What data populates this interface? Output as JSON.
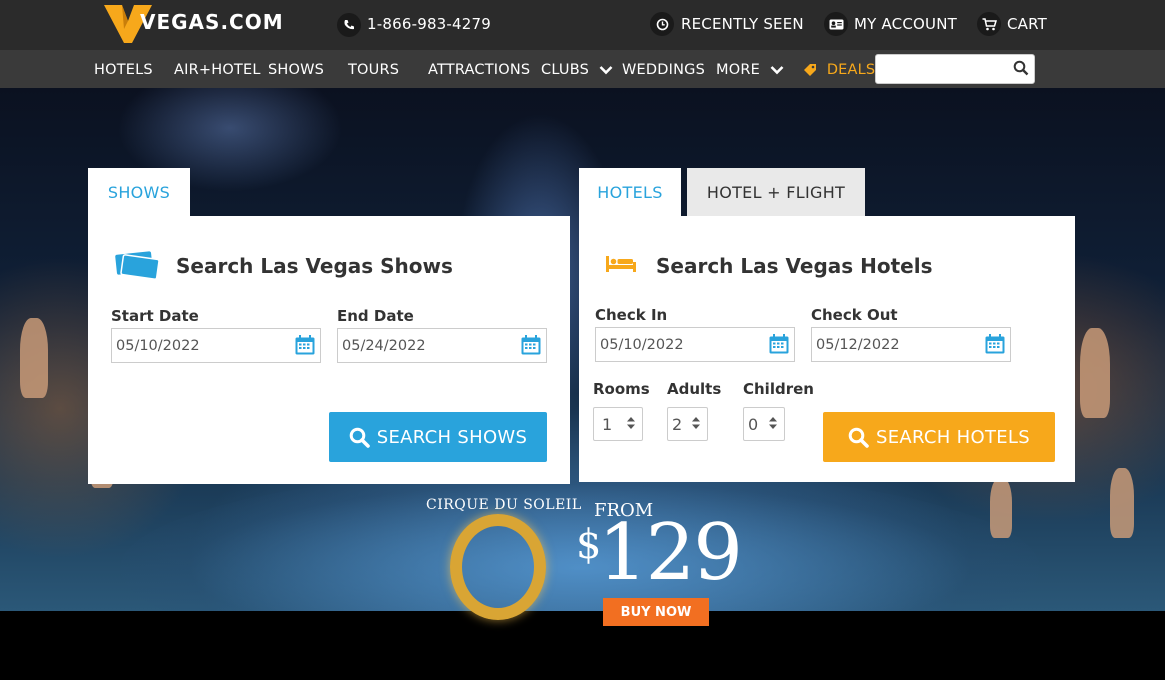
{
  "header": {
    "logo_text": "VEGAS.COM",
    "phone": "1-866-983-4279",
    "recently_seen": "RECENTLY SEEN",
    "my_account": "MY ACCOUNT",
    "cart": "CART",
    "colors": {
      "brand_orange": "#f7a81b",
      "bar": "#2b2b2b"
    }
  },
  "nav": {
    "items": [
      {
        "label": "HOTELS"
      },
      {
        "label": "AIR+HOTEL"
      },
      {
        "label": "SHOWS"
      },
      {
        "label": "TOURS"
      },
      {
        "label": "ATTRACTIONS"
      },
      {
        "label": "CLUBS",
        "dropdown": true
      },
      {
        "label": "WEDDINGS"
      },
      {
        "label": "MORE",
        "dropdown": true
      },
      {
        "label": "DEALS",
        "icon": "tag-icon"
      }
    ],
    "search": {
      "value": "",
      "placeholder": ""
    }
  },
  "shows_widget": {
    "tab": "SHOWS",
    "title": "Search Las Vegas Shows",
    "start_label": "Start Date",
    "start_value": "05/10/2022",
    "end_label": "End Date",
    "end_value": "05/24/2022",
    "button": "SEARCH SHOWS",
    "icon": "tickets-icon",
    "accent": "#29a3dc"
  },
  "hotels_widget": {
    "tabs": [
      {
        "label": "HOTELS"
      },
      {
        "label": "HOTEL + FLIGHT"
      }
    ],
    "title": "Search Las Vegas Hotels",
    "checkin_label": "Check In",
    "checkin_value": "05/10/2022",
    "checkout_label": "Check Out",
    "checkout_value": "05/12/2022",
    "rooms_label": "Rooms",
    "rooms_value": "1",
    "adults_label": "Adults",
    "adults_value": "2",
    "children_label": "Children",
    "children_value": "0",
    "button": "SEARCH HOTELS",
    "icon": "bed-icon",
    "accent": "#f7a81b"
  },
  "promo": {
    "brand": "CIRQUE DU SOLEIL",
    "show_letter": "O",
    "from_label": "FROM",
    "currency": "$",
    "price": "129",
    "cta": "BUY NOW"
  }
}
